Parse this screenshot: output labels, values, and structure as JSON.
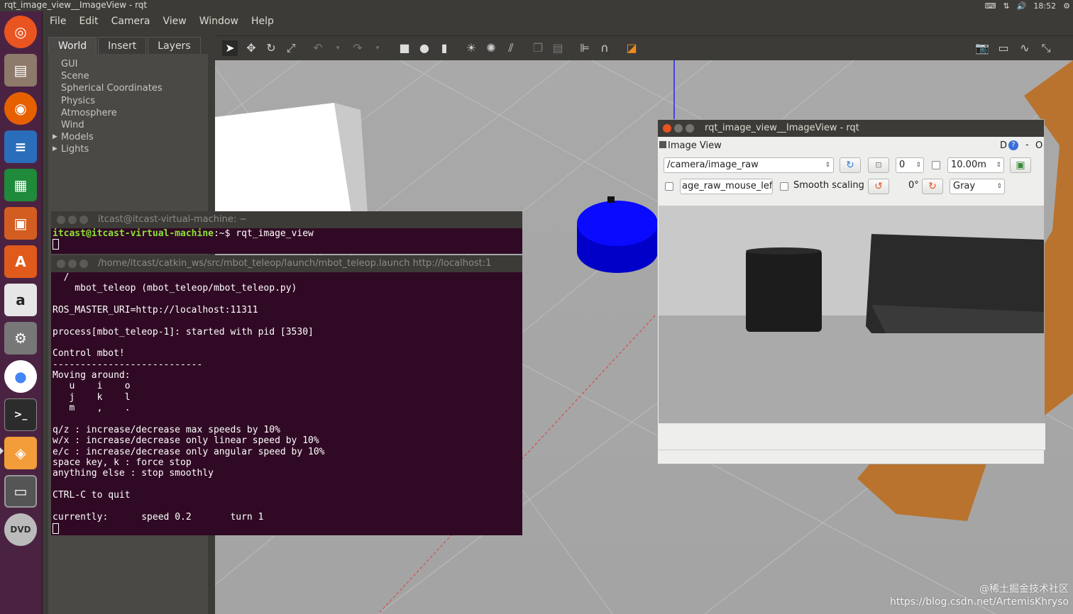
{
  "top_panel": {
    "title": "rqt_image_view__ImageView - rqt",
    "time": "18:52",
    "tray_icons": [
      "keyboard-icon",
      "network-icon",
      "volume-icon",
      "settings-icon"
    ]
  },
  "launcher": {
    "items": [
      {
        "name": "ubuntu-dash-icon",
        "color": "#e95420"
      },
      {
        "name": "files-icon",
        "color": "#8d7a6a"
      },
      {
        "name": "firefox-icon",
        "color": "#e66000"
      },
      {
        "name": "writer-icon",
        "color": "#2a6ebb"
      },
      {
        "name": "calc-icon",
        "color": "#1e8a3a"
      },
      {
        "name": "impress-icon",
        "color": "#d35d20"
      },
      {
        "name": "software-center-icon",
        "color": "#e05a1c"
      },
      {
        "name": "amazon-icon",
        "color": "#e6e6e6"
      },
      {
        "name": "system-settings-icon",
        "color": "#777777"
      },
      {
        "name": "chrome-icon",
        "color": "#4285f4"
      },
      {
        "name": "terminal-icon",
        "color": "#333333"
      },
      {
        "name": "gazebo-icon",
        "color": "#f29c3a"
      },
      {
        "name": "workspace-icon",
        "color": "#555555"
      },
      {
        "name": "dvd-icon",
        "color": "#bbbbbb"
      }
    ]
  },
  "menubar": [
    "File",
    "Edit",
    "Camera",
    "View",
    "Window",
    "Help"
  ],
  "left_panel": {
    "tabs": [
      "World",
      "Insert",
      "Layers"
    ],
    "tree": [
      {
        "label": "GUI",
        "expandable": false
      },
      {
        "label": "Scene",
        "expandable": false
      },
      {
        "label": "Spherical Coordinates",
        "expandable": false
      },
      {
        "label": "Physics",
        "expandable": false
      },
      {
        "label": "Atmosphere",
        "expandable": false
      },
      {
        "label": "Wind",
        "expandable": false
      },
      {
        "label": "Models",
        "expandable": true
      },
      {
        "label": "Lights",
        "expandable": true
      }
    ]
  },
  "toolbar": {
    "tools": [
      "select-arrow-icon",
      "translate-icon",
      "rotate-icon",
      "scale-icon",
      "undo-icon",
      "redo-icon",
      "box-icon",
      "sphere-icon",
      "cylinder-icon",
      "point-light-icon",
      "spot-light-icon",
      "directional-light-icon",
      "copy-icon",
      "paste-icon",
      "align-icon",
      "snap-icon",
      "change-view-icon"
    ],
    "right_tools": [
      "screenshot-icon",
      "plot-icon",
      "fullscreen-icon"
    ]
  },
  "terminal1": {
    "title": "itcast@itcast-virtual-machine: ~",
    "prompt": "itcast@itcast-virtual-machine",
    "prompt_suffix": ":~$ ",
    "command": "rqt_image_view"
  },
  "terminal2": {
    "title": "/home/itcast/catkin_ws/src/mbot_teleop/launch/mbot_teleop.launch http://localhost:1",
    "output": "  /\n    mbot_teleop (mbot_teleop/mbot_teleop.py)\n\nROS_MASTER_URI=http://localhost:11311\n\nprocess[mbot_teleop-1]: started with pid [3530]\n\nControl mbot!\n---------------------------\nMoving around:\n   u    i    o\n   j    k    l\n   m    ,    .\n\nq/z : increase/decrease max speeds by 10%\nw/x : increase/decrease only linear speed by 10%\ne/c : increase/decrease only angular speed by 10%\nspace key, k : force stop\nanything else : stop smoothly\n\nCTRL-C to quit\n\ncurrently:\tspeed 0.2\tturn 1"
  },
  "rqt": {
    "title": "rqt_image_view__ImageView - rqt",
    "plugin_title": "Image View",
    "header_buttons": [
      "D",
      "?",
      "-",
      "O"
    ],
    "topic": "/camera/image_raw",
    "frame_value": "0",
    "max_range": "10.00m",
    "mouse_topic": "age_raw_mouse_left",
    "smooth_scaling_label": "Smooth scaling",
    "rotation": "0°",
    "color_scheme": "Gray"
  },
  "watermark": {
    "line1": "@稀土掘金技术社区",
    "line2": "https://blog.csdn.net/ArtemisKhryso"
  }
}
